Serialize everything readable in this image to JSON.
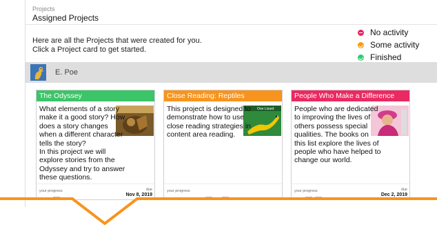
{
  "header": {
    "breadcrumb": "Projects",
    "title": "Assigned Projects"
  },
  "intro": {
    "line1": "Here are all the Projects that were created for you.",
    "line2": "Click a Project card to get started."
  },
  "legend": [
    {
      "label": "No activity",
      "color": "#e8265e",
      "icon": "x-circle-icon"
    },
    {
      "label": "Some activity",
      "color": "#f39c12",
      "icon": "check-circle-icon"
    },
    {
      "label": "Finished",
      "color": "#2ecc71",
      "icon": "check-circle-icon"
    }
  ],
  "student": {
    "name": "E. Poe"
  },
  "cards": [
    {
      "title": "The Odyssey",
      "color": "#3cc468",
      "desc_lines": [
        "What elements of a story",
        "make it a good story? How",
        "does a story changes",
        "when a different character",
        "tells the story?",
        "In this project we will",
        "explore stories from the",
        "Odyssey and try to answer",
        "these questions."
      ],
      "progress_label": "your progress",
      "due_label": "due",
      "due_date": "Nov 8, 2019"
    },
    {
      "title": "Close Reading: Reptiles",
      "color": "#f7941d",
      "desc_lines": [
        "This project is designed to",
        "demonstrate how to use",
        "close reading strategies in",
        "content area reading."
      ],
      "progress_label": "your progress",
      "due_label": "",
      "due_date": ""
    },
    {
      "title": "People Who Make a Difference",
      "color": "#ea2a62",
      "desc_lines": [
        "People who are dedicated",
        "to improving the lives of",
        "others possess special",
        "qualities. The books on",
        "this list explore the lives of",
        "people who have helped to",
        "change our world."
      ],
      "progress_label": "your progress",
      "due_label": "due",
      "due_date": "Dec 2, 2019"
    }
  ],
  "colors": {
    "pointer": "#f7941d",
    "bar_bg": "#dedede"
  }
}
